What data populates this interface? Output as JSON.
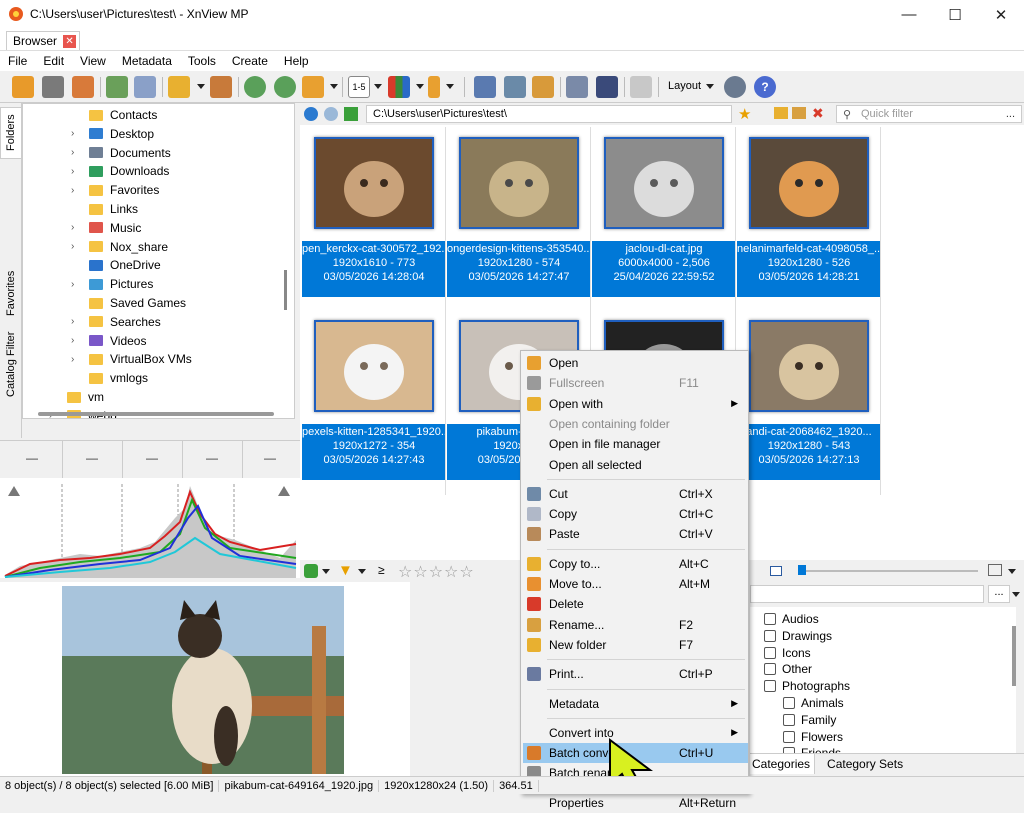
{
  "window": {
    "title": "C:\\Users\\user\\Pictures\\test\\ - XnView MP",
    "minimize": "—",
    "maximize": "☐",
    "close": "✕"
  },
  "tabs": [
    {
      "label": "Browser",
      "close": "✕"
    }
  ],
  "menu": [
    "File",
    "Edit",
    "View",
    "Metadata",
    "Tools",
    "Create",
    "Help"
  ],
  "toolbar": {
    "layout_label": "Layout",
    "view_label": "1-5"
  },
  "side_tabs": [
    "Folders",
    "Favorites",
    "Catalog Filter"
  ],
  "folder_tree": [
    {
      "label": "Contacts",
      "expandable": false,
      "color": "#f5c342"
    },
    {
      "label": "Desktop",
      "expandable": true,
      "color": "#2f7dd1"
    },
    {
      "label": "Documents",
      "expandable": true,
      "color": "#6f7f95"
    },
    {
      "label": "Downloads",
      "expandable": true,
      "color": "#2f9e5e"
    },
    {
      "label": "Favorites",
      "expandable": true,
      "color": "#f5c342"
    },
    {
      "label": "Links",
      "expandable": false,
      "color": "#f5c342"
    },
    {
      "label": "Music",
      "expandable": true,
      "color": "#e0554b"
    },
    {
      "label": "Nox_share",
      "expandable": true,
      "color": "#f5c342"
    },
    {
      "label": "OneDrive",
      "expandable": false,
      "color": "#2a73cc"
    },
    {
      "label": "Pictures",
      "expandable": true,
      "color": "#3d9ad6"
    },
    {
      "label": "Saved Games",
      "expandable": false,
      "color": "#f5c342"
    },
    {
      "label": "Searches",
      "expandable": true,
      "color": "#f5c342"
    },
    {
      "label": "Videos",
      "expandable": true,
      "color": "#7a57c8"
    },
    {
      "label": "VirtualBox VMs",
      "expandable": true,
      "color": "#f5c342"
    },
    {
      "label": "vmlogs",
      "expandable": false,
      "color": "#f5c342"
    },
    {
      "label": "vm",
      "expandable": false,
      "color": "#f5c342"
    },
    {
      "label": "webp",
      "expandable": true,
      "color": "#f5c342"
    }
  ],
  "histogram_header": [
    "—",
    "—",
    "—",
    "—",
    "—"
  ],
  "address": {
    "path": "C:\\Users\\user\\Pictures\\test\\",
    "quick_filter_placeholder": "Quick filter",
    "more": "..."
  },
  "thumbnails": [
    {
      "name": "pen_kerckx-cat-300572_192...",
      "dims": "1920x1610 - 773",
      "date": "03/05/2026 14:28:04",
      "colors": [
        "#6b4a2e",
        "#c9a27a",
        "#3a2a1e"
      ]
    },
    {
      "name": "ongerdesign-kittens-353540...",
      "dims": "1920x1280 - 574",
      "date": "03/05/2026 14:27:47",
      "colors": [
        "#8a7a5a",
        "#c8b48a",
        "#4a4a4a"
      ]
    },
    {
      "name": "jaclou-dl-cat.jpg",
      "dims": "6000x4000 - 2,506",
      "date": "25/04/2026 22:59:52",
      "colors": [
        "#8c8c8c",
        "#dcdcdc",
        "#5a5a5a"
      ]
    },
    {
      "name": "nelanimarfeld-cat-4098058_...",
      "dims": "1920x1280 - 526",
      "date": "03/05/2026 14:28:21",
      "colors": [
        "#5a4a3a",
        "#e09a50",
        "#2a2a2a"
      ]
    },
    {
      "name": "pexels-kitten-1285341_1920...",
      "dims": "1920x1272 - 354",
      "date": "03/05/2026 14:27:43",
      "colors": [
        "#d8b890",
        "#f4f4f4",
        "#7a6a5a"
      ]
    },
    {
      "name": "pikabum-cat-64...",
      "dims": "1920x12...",
      "date": "03/05/2026 14:...",
      "colors": [
        "#c8c0b8",
        "#f2f0ee",
        "#6a5a4a"
      ]
    },
    {
      "name": "",
      "dims": "",
      "date": "",
      "colors": [
        "#222222",
        "#999999",
        "#444444"
      ]
    },
    {
      "name": "andi-cat-2068462_1920...",
      "dims": "1920x1280 - 543",
      "date": "03/05/2026 14:27:13",
      "colors": [
        "#8a7a66",
        "#d8c4a0",
        "#3a2e24"
      ]
    }
  ],
  "filter_bar": {
    "ge": "≥",
    "stars": "☆☆☆☆☆"
  },
  "categories": [
    {
      "label": "Audios",
      "indent": 0
    },
    {
      "label": "Drawings",
      "indent": 0
    },
    {
      "label": "Icons",
      "indent": 0
    },
    {
      "label": "Other",
      "indent": 0
    },
    {
      "label": "Photographs",
      "indent": 0
    },
    {
      "label": "Animals",
      "indent": 1
    },
    {
      "label": "Family",
      "indent": 1
    },
    {
      "label": "Flowers",
      "indent": 1
    },
    {
      "label": "Friends",
      "indent": 1
    }
  ],
  "category_tabs": [
    "Categories",
    "Category Sets"
  ],
  "right_search_more": "...",
  "context_menu": [
    {
      "label": "Open",
      "shortcut": "",
      "sub": false,
      "disabled": false,
      "icon": "#e8a030"
    },
    {
      "label": "Fullscreen",
      "shortcut": "F11",
      "sub": false,
      "disabled": true,
      "icon": "#9a9a9a"
    },
    {
      "label": "Open with",
      "shortcut": "",
      "sub": true,
      "disabled": false,
      "icon": "#e8b030"
    },
    {
      "label": "Open containing folder",
      "shortcut": "",
      "sub": false,
      "disabled": true,
      "icon": ""
    },
    {
      "label": "Open in file manager",
      "shortcut": "",
      "sub": false,
      "disabled": false,
      "icon": ""
    },
    {
      "label": "Open all selected",
      "shortcut": "",
      "sub": false,
      "disabled": false,
      "icon": ""
    },
    {
      "sep": true
    },
    {
      "label": "Cut",
      "shortcut": "Ctrl+X",
      "sub": false,
      "disabled": false,
      "icon": "#6f8aa8"
    },
    {
      "label": "Copy",
      "shortcut": "Ctrl+C",
      "sub": false,
      "disabled": false,
      "icon": "#b0b8c8"
    },
    {
      "label": "Paste",
      "shortcut": "Ctrl+V",
      "sub": false,
      "disabled": false,
      "icon": "#b88a5a"
    },
    {
      "sep": true
    },
    {
      "label": "Copy to...",
      "shortcut": "Alt+C",
      "sub": false,
      "disabled": false,
      "icon": "#e8b030"
    },
    {
      "label": "Move to...",
      "shortcut": "Alt+M",
      "sub": false,
      "disabled": false,
      "icon": "#e89030"
    },
    {
      "label": "Delete",
      "shortcut": "",
      "sub": false,
      "disabled": false,
      "icon": "#d83a2a"
    },
    {
      "label": "Rename...",
      "shortcut": "F2",
      "sub": false,
      "disabled": false,
      "icon": "#d8a040"
    },
    {
      "label": "New folder",
      "shortcut": "F7",
      "sub": false,
      "disabled": false,
      "icon": "#e8b030"
    },
    {
      "sep": true
    },
    {
      "label": "Print...",
      "shortcut": "Ctrl+P",
      "sub": false,
      "disabled": false,
      "icon": "#6a7aa0"
    },
    {
      "sep": true
    },
    {
      "label": "Metadata",
      "shortcut": "",
      "sub": true,
      "disabled": false,
      "icon": ""
    },
    {
      "sep": true
    },
    {
      "label": "Convert into",
      "shortcut": "",
      "sub": true,
      "disabled": false,
      "icon": ""
    },
    {
      "label": "Batch convert...",
      "shortcut": "Ctrl+U",
      "sub": false,
      "disabled": false,
      "icon": "#d87a2a",
      "highlight": true
    },
    {
      "label": "Batch rename...",
      "shortcut": "",
      "sub": false,
      "disabled": false,
      "icon": "#8a8a8a"
    },
    {
      "sep": true
    },
    {
      "label": "Properties",
      "shortcut": "Alt+Return",
      "sub": false,
      "disabled": false,
      "icon": ""
    }
  ],
  "status": [
    "8 object(s) / 8 object(s) selected [6.00 MiB]",
    "pikabum-cat-649164_1920.jpg",
    "1920x1280x24 (1.50)",
    "364.51"
  ]
}
